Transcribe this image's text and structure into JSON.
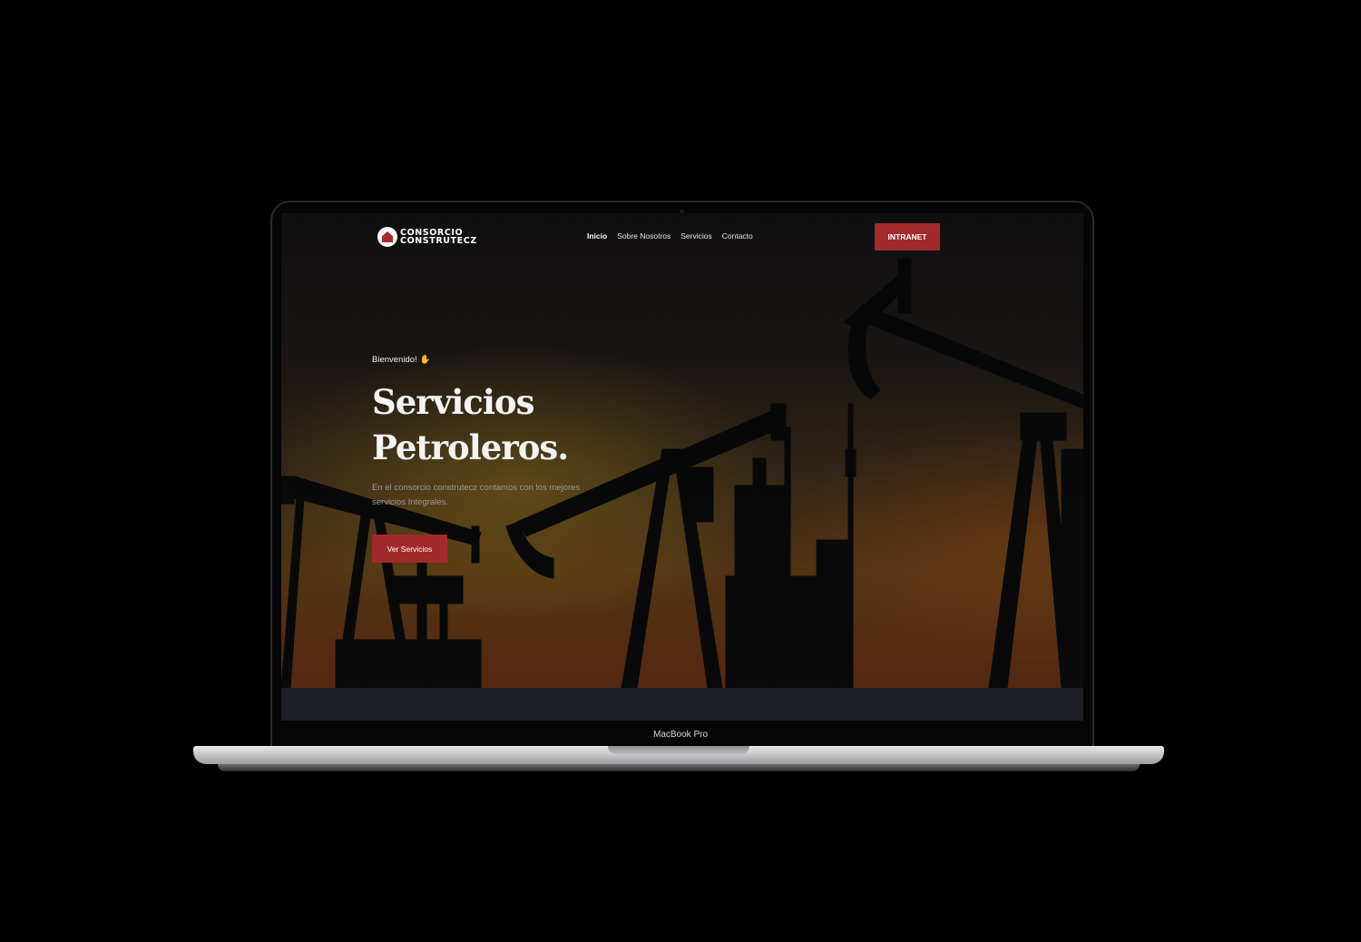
{
  "device": {
    "label": "MacBook Pro"
  },
  "site": {
    "logo": {
      "line1": "CONSORCIO",
      "line2": "CONSTRUTECZ",
      "accent_color": "#a52a2a"
    },
    "nav": {
      "items": [
        {
          "label": "Inicio",
          "active": true
        },
        {
          "label": "Sobre Nosotros",
          "active": false
        },
        {
          "label": "Servicios",
          "active": false
        },
        {
          "label": "Contacto",
          "active": false
        }
      ]
    },
    "intranet_button": {
      "label": "INTRANET",
      "color": "#a22a2d"
    },
    "hero": {
      "welcome": "Bienvenido!",
      "welcome_icon": "waving-hand-icon",
      "headline_line1": "Servicios",
      "headline_line2": "Petroleros.",
      "description": "En el consorcio construtecz contamos con los mejores servicios Integrales.",
      "cta_label": "Ver Servicios"
    }
  }
}
